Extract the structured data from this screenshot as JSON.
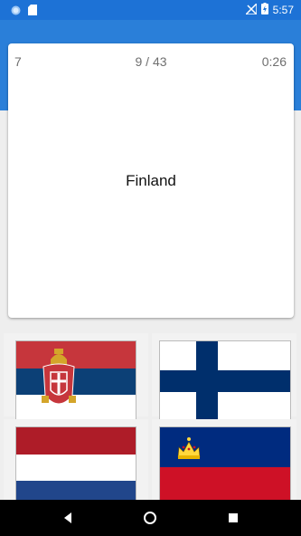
{
  "status_bar": {
    "time": "5:57",
    "icons": [
      "app-notification-icon",
      "sd-card-icon",
      "no-signal-icon",
      "battery-charging-icon"
    ]
  },
  "quiz": {
    "score": "7",
    "progress": "9 / 43",
    "timer": "0:26",
    "question": "Finland"
  },
  "answers": [
    {
      "country_flag": "serbia"
    },
    {
      "country_flag": "finland"
    },
    {
      "country_flag": "netherlands"
    },
    {
      "country_flag": "liechtenstein"
    }
  ],
  "nav_bar": {
    "icons": [
      "back-icon",
      "home-icon",
      "recents-icon"
    ]
  },
  "colors": {
    "primary": "#2a7fd9",
    "status_bar": "#1d72d6"
  }
}
